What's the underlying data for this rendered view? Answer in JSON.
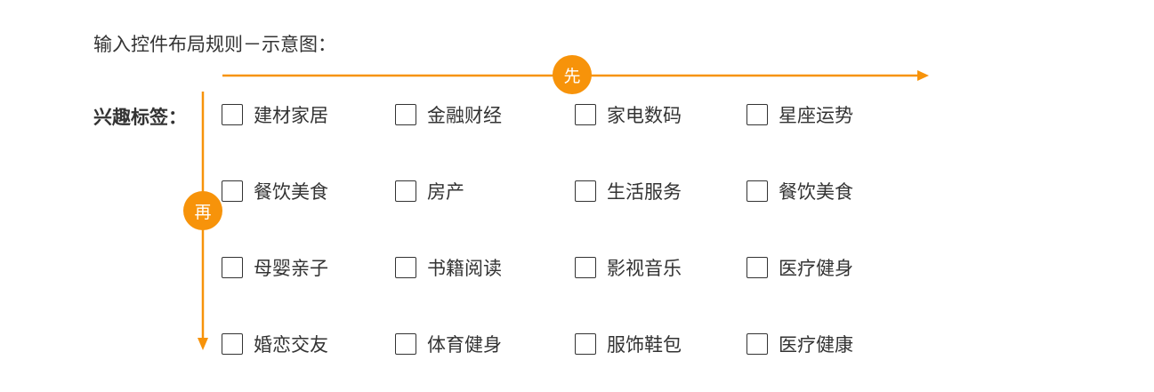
{
  "title": "输入控件布局规则－示意图：",
  "accent_color": "#F7930A",
  "badges": {
    "first": "先",
    "then": "再"
  },
  "field_label": "兴趣标签：",
  "rows": [
    [
      "建材家居",
      "金融财经",
      "家电数码",
      "星座运势"
    ],
    [
      "餐饮美食",
      "房产",
      "生活服务",
      "餐饮美食"
    ],
    [
      "母婴亲子",
      "书籍阅读",
      "影视音乐",
      "医疗健身"
    ],
    [
      "婚恋交友",
      "体育健身",
      "服饰鞋包",
      "医疗健康"
    ]
  ]
}
